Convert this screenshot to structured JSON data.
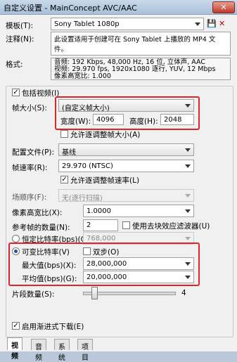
{
  "window": {
    "title": "自定义设置 - MainConcept AVC/AAC",
    "close": "✕"
  },
  "template": {
    "label": "模板(T):",
    "value": "Sony Tablet 1080p"
  },
  "notes": {
    "label": "注释(N):",
    "value": "此设置适用于创建可在 Sony Tablet 上播放的 MP4 文件。"
  },
  "format": {
    "label": "格式:",
    "lines": [
      "音频: 192 Kbps, 48,000 Hz, 16 位, 立体声, AAC",
      "视频: 29.970 fps, 1920x1080 逐行, YUV, 12 Mbps",
      "像素高宽比: 1.000"
    ]
  },
  "include_video": {
    "label": "包括视频(I)",
    "checked": true
  },
  "frame_size": {
    "label": "帧大小(S):",
    "value": "(自定义帧大小)"
  },
  "width": {
    "label": "宽度(W):",
    "value": "4096"
  },
  "height": {
    "label": "高度(H):",
    "value": "2048"
  },
  "allow_frame_adjust": {
    "label": "允许逐调整帧大小(A)",
    "checked": false
  },
  "profile": {
    "label": "配置文件(P):",
    "value": "基线"
  },
  "frame_rate": {
    "label": "帧速率(R):",
    "value": "29.970 (NTSC)"
  },
  "allow_rate_adjust": {
    "label": "允许逐调整帧速率(L)",
    "checked": true
  },
  "field_order": {
    "label": "场顺序(F):",
    "value": "无(逐行扫描)"
  },
  "pixel_aspect": {
    "label": "像素高宽比(X):",
    "value": "1.0000"
  },
  "ref_frames": {
    "label": "参考帧的数量(N):",
    "value": "2",
    "deblock_label": "使用去块效应滤波器(U)"
  },
  "cbr": {
    "label": "恒定比特率(bps)(C):",
    "value": "768,000"
  },
  "vbr": {
    "label": "可变比特率(V)",
    "twopass_label": "双步(O)"
  },
  "max_bps": {
    "label": "最大值(bps)(X):",
    "value": "28,000,000"
  },
  "avg_bps": {
    "label": "平均值(bps)(G):",
    "value": "20,000,000"
  },
  "slices": {
    "label": "片段数量(S):",
    "value": "4",
    "fraction": 0.1
  },
  "progressive_download": {
    "label": "启用渐进式下载(E)",
    "checked": true
  },
  "tabs": [
    "视频",
    "音频",
    "系统",
    "项目"
  ]
}
